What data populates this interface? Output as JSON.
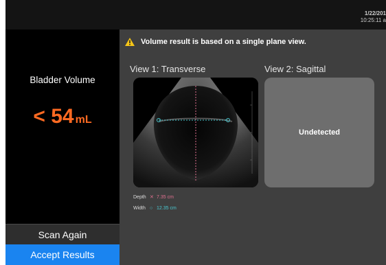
{
  "header": {
    "date": "1/22/201",
    "time": "10:25:11 a"
  },
  "result_panel": {
    "label": "Bladder Volume",
    "value_prefix": "< ",
    "value": "54",
    "unit": "mL",
    "value_color": "#ff6a22"
  },
  "actions": {
    "scan_again": "Scan Again",
    "accept_results": "Accept Results"
  },
  "warning": {
    "text": "Volume result is based on a single plane view.",
    "icon": "warning-triangle-icon"
  },
  "views": [
    {
      "title": "View 1: Transverse"
    },
    {
      "title": "View 2: Sagittal",
      "status": "Undetected"
    }
  ],
  "measurements": {
    "depth": {
      "label": "Depth",
      "icon": "x-marker-icon",
      "value": "7.35 cm",
      "color": "#e07090"
    },
    "width": {
      "label": "Width",
      "icon": "circle-marker-icon",
      "value": "12.35 cm",
      "color": "#4ac8d0"
    }
  },
  "colors": {
    "accent": "#1a84f0",
    "panel": "#3f3f3f",
    "undetected_box": "#6e6e6e"
  }
}
